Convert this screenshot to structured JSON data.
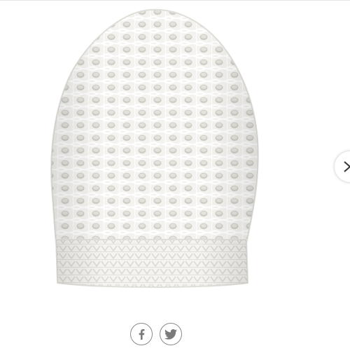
{
  "product": {
    "image_icon": "knit-beanie-hat-image",
    "color": "#f3f2ee"
  },
  "carousel": {
    "next_icon": "chevron-right-icon"
  },
  "share": {
    "buttons": [
      {
        "icon": "facebook-icon",
        "network": "Facebook"
      },
      {
        "icon": "twitter-icon",
        "network": "Twitter"
      }
    ],
    "icon_color": "#7a7a7a"
  }
}
